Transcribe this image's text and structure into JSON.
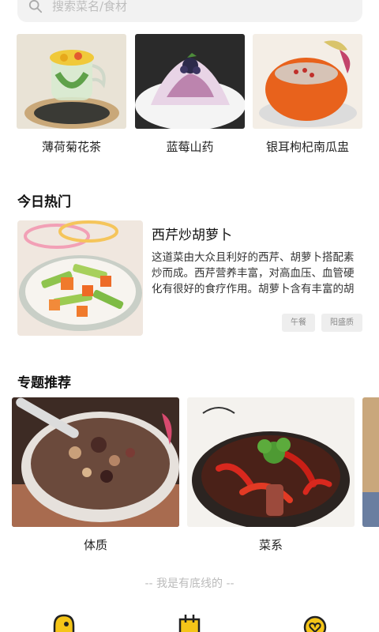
{
  "search": {
    "placeholder": "搜索菜名/食材"
  },
  "top_items": [
    {
      "label": "薄荷菊花茶"
    },
    {
      "label": "蓝莓山药"
    },
    {
      "label": "银耳枸杞南瓜盅"
    }
  ],
  "hot_section": {
    "title": "今日热门",
    "card": {
      "title": "西芹炒胡萝卜",
      "description": "这道菜由大众且利好的西芹、胡萝卜搭配素炒而成。西芹营养丰富，对高血压、血管硬化有很好的食疗作用。胡萝卜含有丰富的胡萝卜…",
      "tags": [
        "午餐",
        "阳盛质"
      ]
    }
  },
  "topic_section": {
    "title": "专题推荐",
    "items": [
      {
        "label": "体质"
      },
      {
        "label": "菜系"
      }
    ]
  },
  "footer": {
    "text": "-- 我是有底线的 --"
  },
  "tabbar": {
    "icons": [
      "home-icon",
      "recipe-icon",
      "heart-icon"
    ]
  },
  "colors": {
    "accent": "#f5c518",
    "tag_bg": "#eeeeee",
    "search_bg": "#f2f2f2"
  }
}
